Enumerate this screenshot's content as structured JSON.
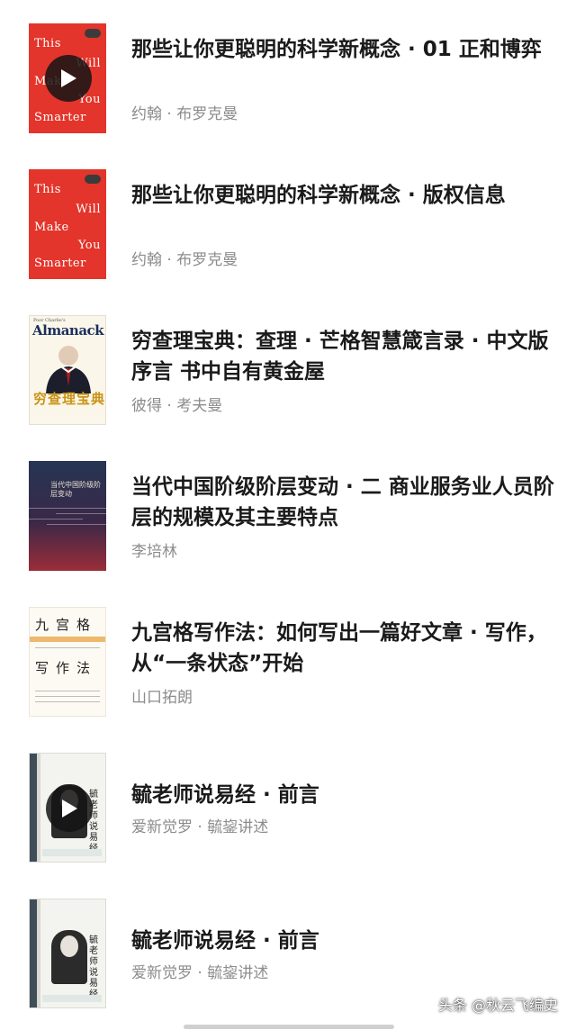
{
  "items": [
    {
      "title": "那些让你更聪明的科学新概念 · 01 正和博弈",
      "author": "约翰 · 布罗克曼",
      "has_play": true,
      "cover": "this-will-make-you-smarter"
    },
    {
      "title": "那些让你更聪明的科学新概念 · 版权信息",
      "author": "约翰 · 布罗克曼",
      "has_play": false,
      "cover": "this-will-make-you-smarter"
    },
    {
      "title": "穷查理宝典：查理 · 芒格智慧箴言录 · 中文版序言 书中自有黄金屋",
      "author": "彼得 · 考夫曼",
      "has_play": false,
      "cover": "poor-charlies-almanack"
    },
    {
      "title": "当代中国阶级阶层变动 · 二 商业服务业人员阶层的规模及其主要特点",
      "author": "李培林",
      "has_play": false,
      "cover": "china-class-change"
    },
    {
      "title": "九宫格写作法：如何写出一篇好文章 · 写作，从“一条状态”开始",
      "author": "山口拓朗",
      "has_play": false,
      "cover": "nine-grid-writing"
    },
    {
      "title": "毓老师说易经 · 前言",
      "author": "爱新觉罗 · 毓鋆讲述",
      "has_play": true,
      "cover": "yijing"
    },
    {
      "title": "毓老师说易经 · 前言",
      "author": "爱新觉罗 · 毓鋆讲述",
      "has_play": false,
      "cover": "yijing"
    }
  ],
  "covers": {
    "smarter_words": [
      "This",
      "Will",
      "Make",
      "You",
      "Smarter"
    ],
    "smarter_cn": "那些让你更聪明的科学新概念",
    "almanack_top": "Poor Charlie's",
    "almanack_title": "Almanack",
    "almanack_cn": "穷查理宝典",
    "china_title": "当代中国阶级阶层变动",
    "nine_line1": "九宫格",
    "nine_line2": "写作法",
    "yijing_cn": "毓老师说易经"
  },
  "watermark": "头条 @秋云飞编史",
  "colors": {
    "title": "#1a1a1a",
    "author": "#8c8c8c",
    "smarter_red": "#e3352b",
    "alm_blue": "#1c2f5c",
    "alm_gold": "#c99418"
  }
}
